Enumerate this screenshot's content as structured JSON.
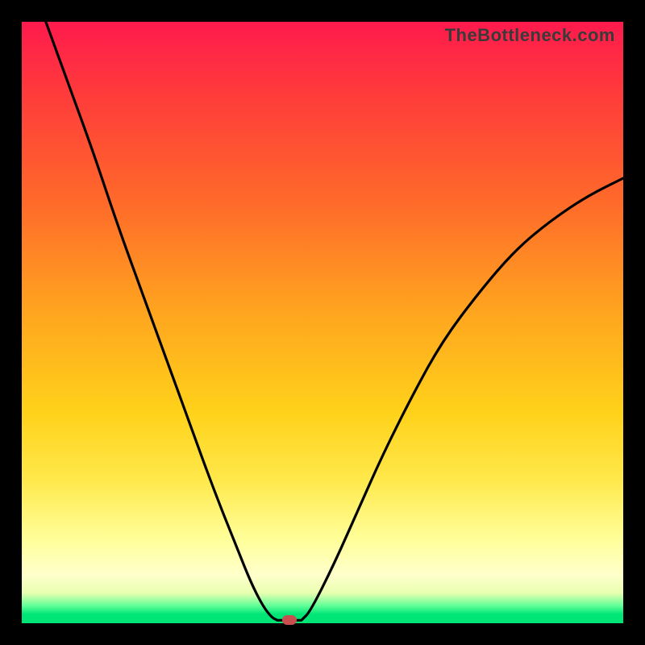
{
  "watermark": "TheBottleneck.com",
  "colors": {
    "frame": "#000000",
    "gradient_top": "#ff1a4d",
    "gradient_mid": "#ffd21a",
    "gradient_bottom": "#00e676",
    "curve": "#000000",
    "marker": "#c94f4f"
  },
  "chart_data": {
    "type": "line",
    "title": "",
    "xlabel": "",
    "ylabel": "",
    "xlim": [
      0,
      100
    ],
    "ylim": [
      0,
      100
    ],
    "grid": false,
    "legend": false,
    "series": [
      {
        "name": "left-branch",
        "x": [
          4,
          8,
          12,
          16,
          20,
          24,
          28,
          32,
          36,
          38,
          40,
          41.5,
          42.5
        ],
        "y": [
          100,
          89,
          78,
          66,
          55,
          44,
          33,
          22,
          12,
          7,
          3,
          1,
          0.5
        ]
      },
      {
        "name": "valley-floor",
        "x": [
          42.5,
          46.5
        ],
        "y": [
          0.5,
          0.5
        ]
      },
      {
        "name": "right-branch",
        "x": [
          46.5,
          48,
          52,
          56,
          60,
          65,
          70,
          76,
          82,
          88,
          94,
          100
        ],
        "y": [
          0.5,
          2,
          10,
          19,
          28,
          38,
          47,
          55,
          62,
          67,
          71,
          74
        ]
      }
    ],
    "marker": {
      "x": 44.5,
      "y": 0.6
    },
    "ticks": {
      "x": [],
      "y": []
    },
    "annotations": []
  }
}
